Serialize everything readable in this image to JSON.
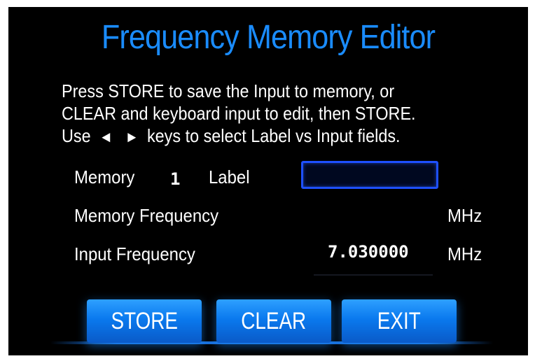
{
  "title": "Frequency Memory Editor",
  "instructions": {
    "line1": "Press STORE to save the Input to memory, or",
    "line2": "CLEAR and keyboard input to edit, then STORE.",
    "line3_prefix": "Use",
    "line3_suffix": "keys to select Label vs Input fields."
  },
  "icons": {
    "left_arrow": "◄",
    "right_arrow": "►"
  },
  "memory_row": {
    "memory_label": "Memory",
    "memory_number": "1",
    "label_label": "Label",
    "label_value": ""
  },
  "memory_frequency": {
    "label": "Memory Frequency",
    "value": "",
    "unit": "MHz"
  },
  "input_frequency": {
    "label": "Input Frequency",
    "value": "7.030000",
    "unit": "MHz"
  },
  "buttons": {
    "store": "STORE",
    "clear": "CLEAR",
    "exit": "EXIT"
  },
  "colors": {
    "title": "#1a8cff",
    "background": "#000000",
    "button": "#0a79ee",
    "field_border": "#1e50ff"
  }
}
